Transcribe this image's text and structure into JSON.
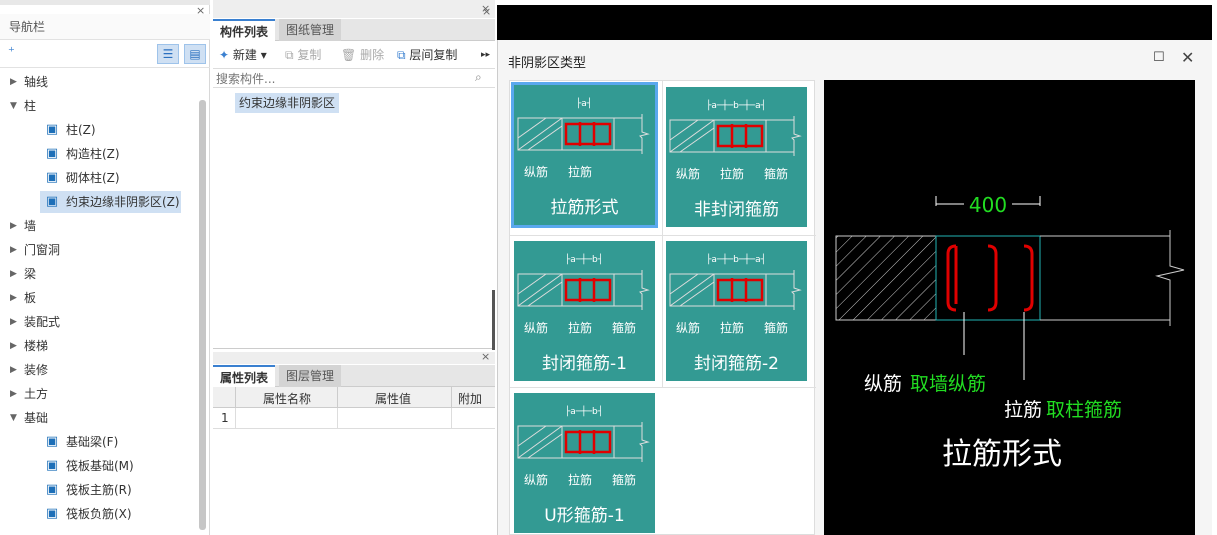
{
  "nav": {
    "title": "导航栏",
    "close": "×",
    "tree": [
      {
        "label": "轴线",
        "expanded": false
      },
      {
        "label": "柱",
        "expanded": true,
        "children": [
          {
            "label": "柱(Z)",
            "icon": "column-icon"
          },
          {
            "label": "构造柱(Z)",
            "icon": "constructional-column-icon"
          },
          {
            "label": "砌体柱(Z)",
            "icon": "masonry-column-icon"
          },
          {
            "label": "约束边缘非阴影区(Z)",
            "icon": "boundary-zone-icon",
            "selected": true
          }
        ]
      },
      {
        "label": "墙",
        "expanded": false
      },
      {
        "label": "门窗洞",
        "expanded": false
      },
      {
        "label": "梁",
        "expanded": false
      },
      {
        "label": "板",
        "expanded": false
      },
      {
        "label": "装配式",
        "expanded": false
      },
      {
        "label": "楼梯",
        "expanded": false
      },
      {
        "label": "装修",
        "expanded": false
      },
      {
        "label": "土方",
        "expanded": false
      },
      {
        "label": "基础",
        "expanded": true,
        "children": [
          {
            "label": "基础梁(F)",
            "icon": "foundation-beam-icon"
          },
          {
            "label": "筏板基础(M)",
            "icon": "raft-foundation-icon"
          },
          {
            "label": "筏板主筋(R)",
            "icon": "raft-main-rebar-icon"
          },
          {
            "label": "筏板负筋(X)",
            "icon": "raft-negative-rebar-icon"
          }
        ]
      }
    ]
  },
  "components": {
    "tabs": [
      "构件列表",
      "图纸管理"
    ],
    "toolbar": {
      "new": "新建",
      "copy": "复制",
      "delete": "删除",
      "floor_copy": "层间复制"
    },
    "search_placeholder": "搜索构件...",
    "items": [
      "约束边缘非阴影区"
    ]
  },
  "properties": {
    "tabs": [
      "属性列表",
      "图层管理"
    ],
    "columns": [
      "属性名称",
      "属性值",
      "附加"
    ],
    "rows": [
      {
        "index": "1",
        "name": "",
        "value": "",
        "extra": ""
      }
    ]
  },
  "dialog": {
    "title": "非阴影区类型",
    "options": [
      {
        "label": "拉筋形式",
        "selected": true,
        "dims": [
          "a"
        ],
        "notes": [
          "纵筋",
          "拉筋"
        ]
      },
      {
        "label": "非封闭箍筋",
        "selected": false,
        "dims": [
          "a",
          "b",
          "a"
        ],
        "notes": [
          "纵筋",
          "拉筋",
          "箍筋"
        ]
      },
      {
        "label": "封闭箍筋-1",
        "selected": false,
        "dims": [
          "a",
          "b"
        ],
        "notes": [
          "纵筋",
          "拉筋",
          "箍筋"
        ]
      },
      {
        "label": "封闭箍筋-2",
        "selected": false,
        "dims": [
          "a",
          "b",
          "a"
        ],
        "notes": [
          "纵筋",
          "拉筋",
          "箍筋"
        ]
      },
      {
        "label": "U形箍筋-1",
        "selected": false,
        "dims": [
          "a",
          "b"
        ],
        "notes": [
          "纵筋",
          "拉筋",
          "箍筋"
        ]
      }
    ],
    "preview": {
      "dimension": "400",
      "note1_a": "纵筋",
      "note1_b": "取墙纵筋",
      "note2_a": "拉筋",
      "note2_b": "取柱箍筋",
      "title": "拉筋形式"
    },
    "colors": {
      "card": "#339a93",
      "rebar": "#e00000",
      "highlight": "#22dd22"
    }
  }
}
